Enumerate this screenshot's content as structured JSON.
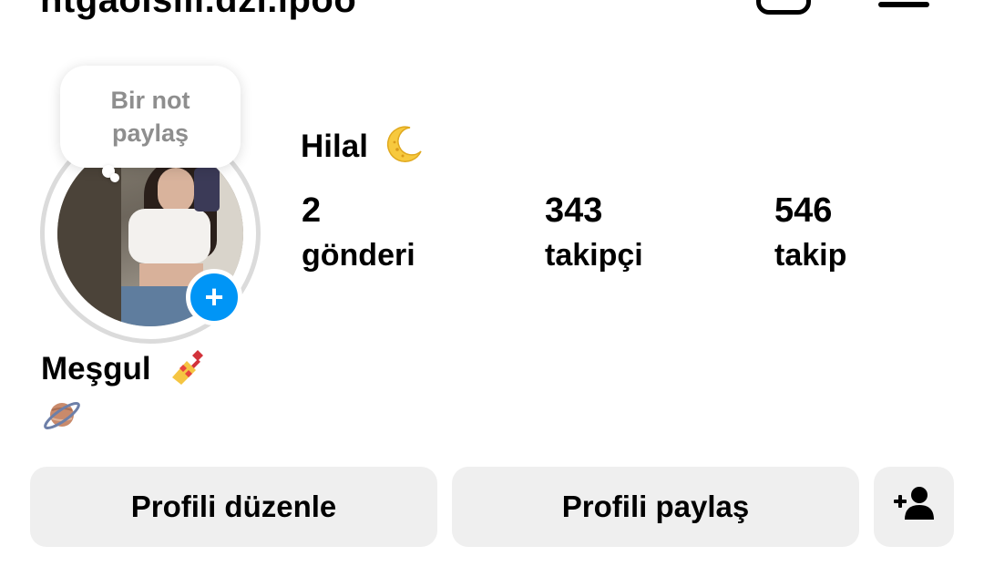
{
  "header": {
    "username": "htgaoisiii.dzi.ipoo",
    "icons": [
      "new-post-icon",
      "menu-icon"
    ]
  },
  "note": {
    "line1": "Bir not",
    "line2": "paylaş"
  },
  "profile": {
    "display_name": "Hilal",
    "name_emoji": "crescent-moon",
    "stats": [
      {
        "value": "2",
        "label": "gönderi"
      },
      {
        "value": "343",
        "label": "takipçi"
      },
      {
        "value": "546",
        "label": "takip"
      }
    ],
    "bio_line1": "Meşgul",
    "bio_line1_emoji": "nail-polish",
    "bio_line2_emoji": "ringed-planet"
  },
  "actions": {
    "edit_profile": "Profili düzenle",
    "share_profile": "Profili paylaş",
    "add_user_icon": "add-person-icon"
  },
  "colors": {
    "accent": "#0095f6",
    "button_bg": "#efefef",
    "ring": "#dbdbdb",
    "note_text": "#8e8e8e"
  }
}
